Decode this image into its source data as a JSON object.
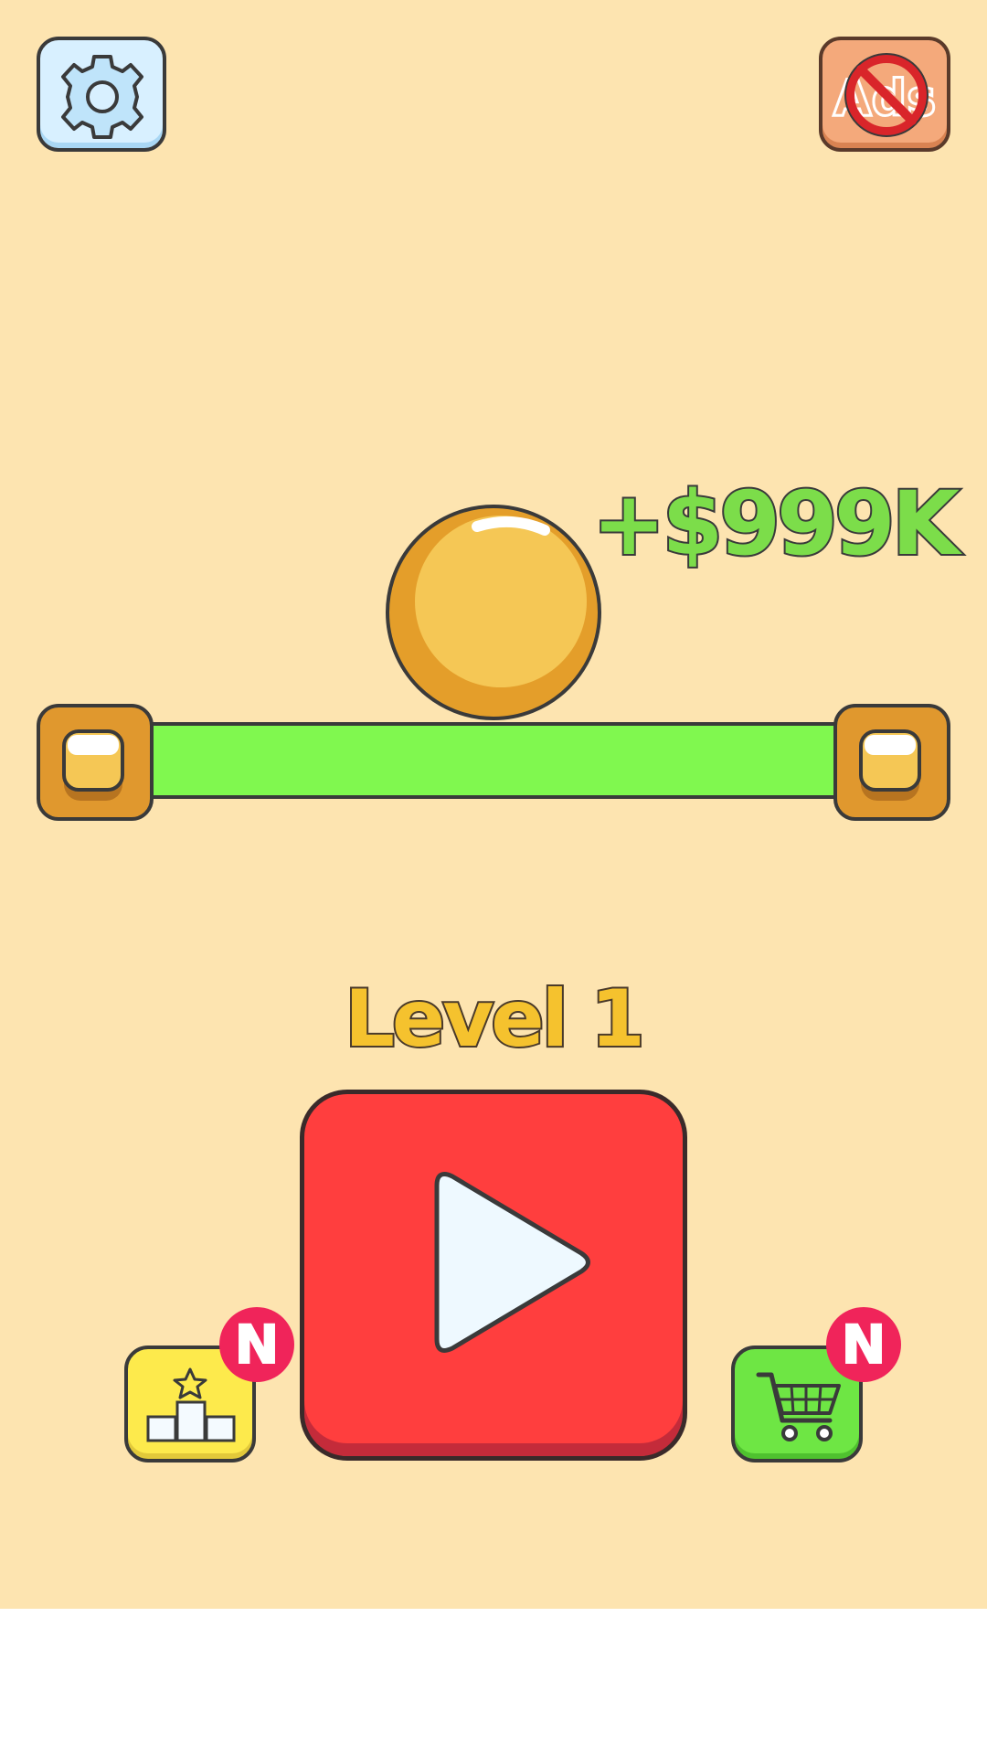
{
  "hud": {
    "reward": "+$999K",
    "level": "Level 1"
  },
  "buttons": {
    "settings_icon": "gear-icon",
    "no_ads_icon": "no-ads-icon",
    "play_icon": "play-icon",
    "leaderboard_icon": "podium-star-icon",
    "shop_icon": "shopping-cart-icon"
  },
  "badges": {
    "leaderboard": "N",
    "shop": "N"
  },
  "colors": {
    "background": "#FDE4B0",
    "platform_bar": "#80F84F",
    "ball": "#F5C755",
    "play_button": "#FF3E3E",
    "reward_text": "#7CDD4A",
    "level_text": "#F5C22E",
    "badge": "#F0245A"
  }
}
